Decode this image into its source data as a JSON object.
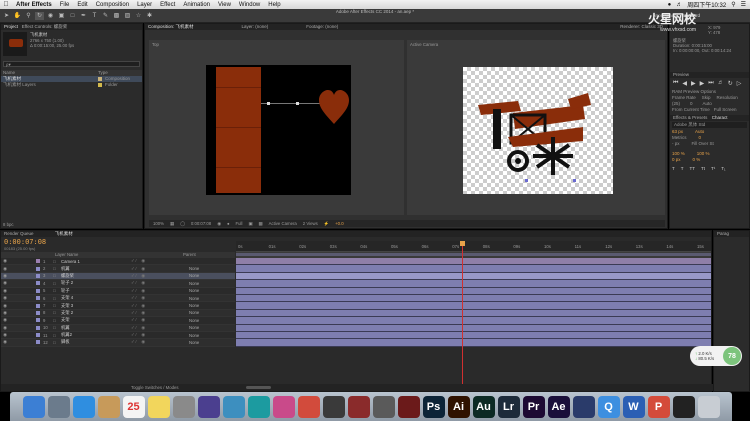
{
  "menubar": {
    "app_name": "After Effects",
    "items": [
      "File",
      "Edit",
      "Composition",
      "Layer",
      "Effect",
      "Animation",
      "View",
      "Window",
      "Help"
    ],
    "clock": "周四下午10:32"
  },
  "window_title": "Adobe After Effects CC 2014 - an.aep *",
  "toolbar": {
    "workspace_label": "Workspace:",
    "workspace_value": "Standard"
  },
  "project_panel": {
    "tab_project": "Project",
    "tab_effect_controls": "Effect Controls: 螺旋桨",
    "comp_name": "飞机素材",
    "comp_info_1": "2766 x 750 (1.00)",
    "comp_info_2": "Δ 0:00:15:00, 25.00 fps",
    "search_placeholder": "ρ▾",
    "col_name": "Name",
    "col_type": "Type",
    "items": [
      {
        "name": "飞机素材",
        "type": "Composition",
        "color": "#c8b27a"
      },
      {
        "name": "飞机素材 Layers",
        "type": "Folder",
        "color": "#d2b94c"
      }
    ],
    "bpc": "8 bpc"
  },
  "comp_viewer_left": {
    "tab": "Composition: 飞机素材",
    "layer_tab": "Layer: (none)",
    "footage_tab": "Footage: (none)",
    "view_label": "Top",
    "zoom": "100%",
    "timecode": "0:00:07:08",
    "resolution": "Full",
    "camera": "Active Camera",
    "views": "2 Views"
  },
  "comp_viewer_right": {
    "view_label": "Active Camera",
    "renderer_label": "Renderer:",
    "renderer_value": "Classic 3D",
    "exposure": "+0.0"
  },
  "info_panel": {
    "x": "X: 979",
    "y": "Y: 478",
    "layer_name": "螺旋桨",
    "duration": "Duration: 0:00:15:00",
    "in_out": "In: 0:00:00:00, Out: 0:00:14:24"
  },
  "preview_panel": {
    "title": "Preview",
    "ram_options": "RAM Preview Options",
    "frame_rate_label": "Frame Rate",
    "skip_label": "Skip",
    "resolution_label": "Resolution",
    "frame_rate": "(25)",
    "skip": "0",
    "resolution": "Auto",
    "from_current": "From Current Time",
    "full_screen": "Full Screen"
  },
  "effects_panel": {
    "tab_effects": "Effects & Presets",
    "tab_character": "Charact",
    "font": "Adobe 黑体 Std",
    "font_size": "63 px",
    "leading": "Auto",
    "metrics": "Metrics",
    "tracking": "0",
    "stroke_size": "- px",
    "stroke_mode": "Fill Over St",
    "vert_scale": "100 %",
    "horiz_scale": "100 %",
    "baseline": "0 px",
    "tsume": "0 %"
  },
  "timeline": {
    "tab_render": "Render Queue",
    "tab_comp": "飞机素材",
    "timecode": "0:00:07:08",
    "frame_info": "00183 (25.00 fps)",
    "col_layer_name": "Layer Name",
    "col_parent": "Parent",
    "layers": [
      {
        "num": "1",
        "name": "Camera 1",
        "parent": "",
        "color": "#9b7fb0"
      },
      {
        "num": "2",
        "name": "机翼",
        "parent": "None",
        "color": "#8c8cc8"
      },
      {
        "num": "3",
        "name": "螺旋桨",
        "parent": "None",
        "color": "#8c8cc8"
      },
      {
        "num": "4",
        "name": "轮子 2",
        "parent": "None",
        "color": "#8c8cc8"
      },
      {
        "num": "5",
        "name": "轮子",
        "parent": "None",
        "color": "#8c8cc8"
      },
      {
        "num": "6",
        "name": "支架 4",
        "parent": "None",
        "color": "#8c8cc8"
      },
      {
        "num": "7",
        "name": "支架 3",
        "parent": "None",
        "color": "#8c8cc8"
      },
      {
        "num": "8",
        "name": "支架 2",
        "parent": "None",
        "color": "#8c8cc8"
      },
      {
        "num": "9",
        "name": "支架",
        "parent": "None",
        "color": "#8c8cc8"
      },
      {
        "num": "10",
        "name": "机翼",
        "parent": "None",
        "color": "#8c8cc8"
      },
      {
        "num": "11",
        "name": "机翼2",
        "parent": "None",
        "color": "#8c8cc8"
      },
      {
        "num": "12",
        "name": "脚板",
        "parent": "None",
        "color": "#8c8cc8"
      }
    ],
    "ruler": [
      "0s",
      "01s",
      "02s",
      "03s",
      "04s",
      "05s",
      "06s",
      "07s",
      "08s",
      "09s",
      "10s",
      "11s",
      "12s",
      "13s",
      "14s",
      "15s"
    ],
    "playhead_seconds": 7.32,
    "duration_seconds": 15,
    "toggle_label": "Toggle Switches / Modes"
  },
  "right_panel_tab": "Parag",
  "network_widget": {
    "up": "2.0 K/s",
    "down": "80.5 K/s",
    "percent": "78"
  },
  "watermark": {
    "cn": "火星网校",
    "url": "www.vhxsd.com"
  },
  "dock": {
    "calendar_day": "25",
    "apps": [
      {
        "id": "finder",
        "label": "",
        "bg": "#3c7fd4"
      },
      {
        "id": "launchpad",
        "label": "",
        "bg": "#6b7b8c"
      },
      {
        "id": "safari",
        "label": "",
        "bg": "#2f8ee0"
      },
      {
        "id": "contacts",
        "label": "",
        "bg": "#c79a5a"
      },
      {
        "id": "calendar",
        "label": "25",
        "bg": "#f4f4f4"
      },
      {
        "id": "notes",
        "label": "",
        "bg": "#f2d65c"
      },
      {
        "id": "prefs",
        "label": "",
        "bg": "#8a8a8a"
      },
      {
        "id": "quicktime",
        "label": "",
        "bg": "#4b3f8f"
      },
      {
        "id": "preview",
        "label": "",
        "bg": "#3d8fbf"
      },
      {
        "id": "maya",
        "label": "",
        "bg": "#1c9ba0"
      },
      {
        "id": "itunes",
        "label": "",
        "bg": "#c94a8a"
      },
      {
        "id": "davinci",
        "label": "",
        "bg": "#d24b3c"
      },
      {
        "id": "finalcut",
        "label": "",
        "bg": "#3a3a3a"
      },
      {
        "id": "photobooth",
        "label": "",
        "bg": "#8a2b2b"
      },
      {
        "id": "motion",
        "label": "",
        "bg": "#5a5a5a"
      },
      {
        "id": "cinema",
        "label": "",
        "bg": "#6b1a1a"
      },
      {
        "id": "ps",
        "label": "Ps",
        "bg": "#0c2437"
      },
      {
        "id": "ai",
        "label": "Ai",
        "bg": "#2f1200"
      },
      {
        "id": "au",
        "label": "Au",
        "bg": "#0c2a24"
      },
      {
        "id": "lr",
        "label": "Lr",
        "bg": "#1d2b3a"
      },
      {
        "id": "pr",
        "label": "Pr",
        "bg": "#1d0a33"
      },
      {
        "id": "ae",
        "label": "Ae",
        "bg": "#1a0f3a"
      },
      {
        "id": "c4d",
        "label": "",
        "bg": "#2a3b6a"
      },
      {
        "id": "qq",
        "label": "Q",
        "bg": "#3d8fe0"
      },
      {
        "id": "word",
        "label": "W",
        "bg": "#2b5fb4"
      },
      {
        "id": "wps",
        "label": "P",
        "bg": "#d44b3a"
      },
      {
        "id": "terminal",
        "label": "",
        "bg": "#222"
      },
      {
        "id": "trash",
        "label": "",
        "bg": "#c8cdd3"
      }
    ]
  },
  "colors": {
    "accent_orange": "#e8a34a",
    "playhead": "#d03030",
    "wood": "#8a2d0a"
  }
}
